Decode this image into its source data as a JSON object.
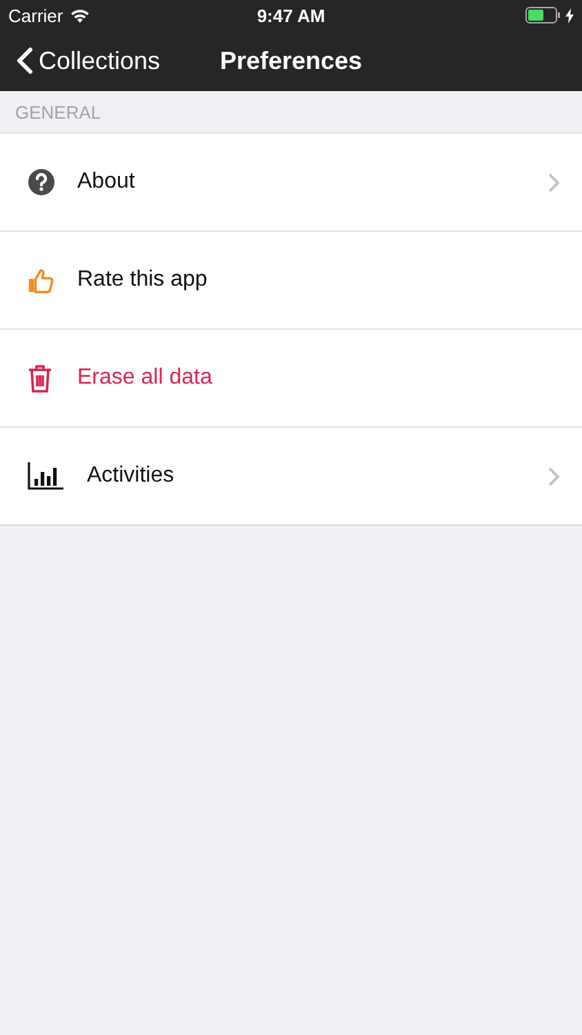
{
  "status_bar": {
    "carrier": "Carrier",
    "time": "9:47 AM"
  },
  "nav_bar": {
    "back_label": "Collections",
    "title": "Preferences"
  },
  "section": {
    "header": "GENERAL",
    "items": [
      {
        "kind": "help",
        "label": "About",
        "chevron": true,
        "destructive": false
      },
      {
        "kind": "rate",
        "label": "Rate this app",
        "chevron": false,
        "destructive": false
      },
      {
        "kind": "erase",
        "label": "Erase all data",
        "chevron": false,
        "destructive": true
      },
      {
        "kind": "chart",
        "label": "Activities",
        "chevron": true,
        "destructive": false
      }
    ]
  }
}
